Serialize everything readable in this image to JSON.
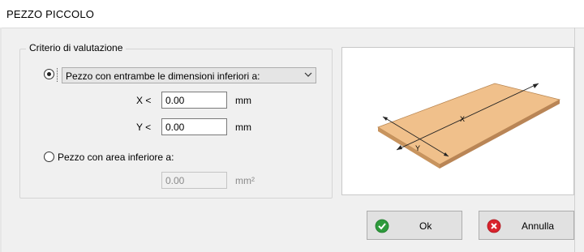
{
  "window": {
    "title": "PEZZO PICCOLO"
  },
  "criteria": {
    "legend": "Criterio di valutazione",
    "option_dimensions": {
      "selected": true,
      "dropdown_value": "Pezzo con entrambe le dimensioni inferiori a:",
      "x_label": "X <",
      "x_value": "0.00",
      "x_unit": "mm",
      "y_label": "Y <",
      "y_value": "0.00",
      "y_unit": "mm"
    },
    "option_area": {
      "selected": false,
      "label": "Pezzo con area inferiore a:",
      "value": "0.00",
      "unit": "mm²"
    }
  },
  "preview": {
    "x_axis_label": "X",
    "y_axis_label": "Y"
  },
  "buttons": {
    "ok_label": "Ok",
    "cancel_label": "Annulla"
  },
  "colors": {
    "board_top": "#f0c08b",
    "board_side": "#c8945e",
    "ok_icon": "#2e9a3c",
    "cancel_icon": "#d9232d"
  }
}
